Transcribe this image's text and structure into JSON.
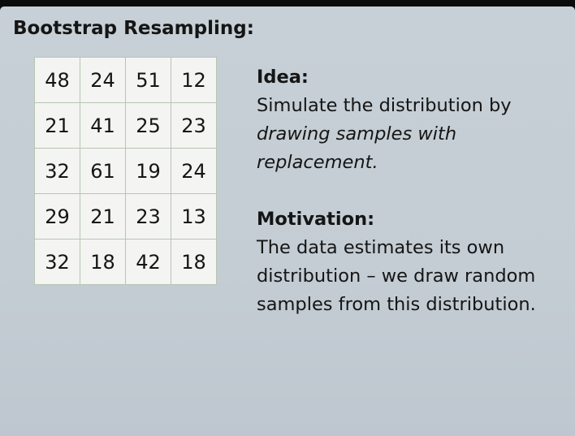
{
  "slide": {
    "title": "Bootstrap Resampling:",
    "grid": [
      [
        "48",
        "24",
        "51",
        "12"
      ],
      [
        "21",
        "41",
        "25",
        "23"
      ],
      [
        "32",
        "61",
        "19",
        "24"
      ],
      [
        "29",
        "21",
        "23",
        "13"
      ],
      [
        "32",
        "18",
        "42",
        "18"
      ]
    ],
    "idea": {
      "heading": "Idea:",
      "text_plain": "Simulate the distribution by ",
      "text_italic": "drawing samples with replacement."
    },
    "motivation": {
      "heading": "Motivation:",
      "text": "The data estimates its own distribution – we draw random samples from this distribution."
    }
  }
}
